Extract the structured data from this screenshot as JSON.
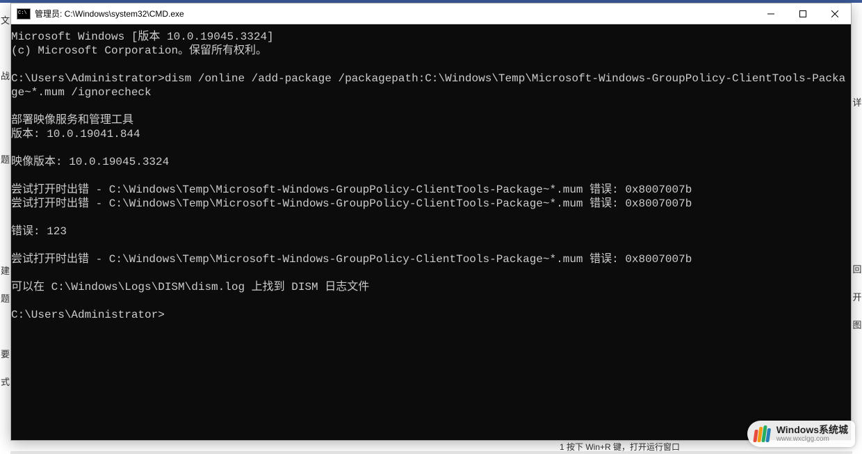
{
  "window": {
    "title": "管理员: C:\\Windows\\system32\\CMD.exe"
  },
  "terminal": {
    "lines": [
      "Microsoft Windows [版本 10.0.19045.3324]",
      "(c) Microsoft Corporation。保留所有权利。",
      "",
      "C:\\Users\\Administrator>dism /online /add-package /packagepath:C:\\Windows\\Temp\\Microsoft-Windows-GroupPolicy-ClientTools-Package~*.mum /ignorecheck",
      "",
      "部署映像服务和管理工具",
      "版本: 10.0.19041.844",
      "",
      "映像版本: 10.0.19045.3324",
      "",
      "尝试打开时出错 - C:\\Windows\\Temp\\Microsoft-Windows-GroupPolicy-ClientTools-Package~*.mum 错误: 0x8007007b",
      "尝试打开时出错 - C:\\Windows\\Temp\\Microsoft-Windows-GroupPolicy-ClientTools-Package~*.mum 错误: 0x8007007b",
      "",
      "错误: 123",
      "",
      "尝试打开时出错 - C:\\Windows\\Temp\\Microsoft-Windows-GroupPolicy-ClientTools-Package~*.mum 错误: 0x8007007b",
      "",
      "可以在 C:\\Windows\\Logs\\DISM\\dism.log 上找到 DISM 日志文件",
      "",
      "C:\\Users\\Administrator>"
    ]
  },
  "background": {
    "left_chars": [
      "文",
      "",
      "战",
      "",
      "",
      "题",
      "",
      "",
      "",
      "建",
      "题",
      "",
      "要",
      "式"
    ],
    "right_chars": [
      "",
      "详",
      "",
      "",
      "",
      "",
      "",
      "回",
      "开",
      "图",
      "",
      "",
      ""
    ],
    "bottom_text": "1 按下 Win+R 键，打开运行窗口"
  },
  "watermark": {
    "title": "Windows系统城",
    "url": "www.wxclgg.com"
  }
}
